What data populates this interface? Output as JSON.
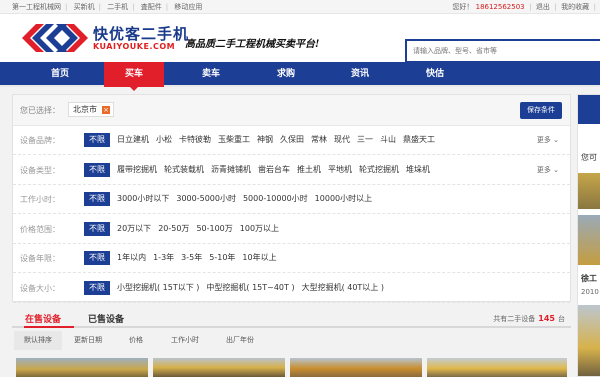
{
  "topbar": {
    "links": [
      "第一工程机械网",
      "买新机",
      "二手机",
      "査配件",
      "移动应用"
    ],
    "greeting": "您好！",
    "phone": "18612562503",
    "logout": "退出",
    "favorites": "我的收藏"
  },
  "header": {
    "logo_cn": "快优客二手机",
    "logo_en": "KUAIYOUKE.COM",
    "slogan": "高品质二手工程机械买卖平台!",
    "search_placeholder": "请输入品牌、型号、省市等"
  },
  "nav": {
    "items": [
      "首页",
      "买车",
      "卖车",
      "求购",
      "资讯",
      "快估"
    ],
    "active": "买车"
  },
  "filter": {
    "selected_label": "您已选择：",
    "selected_chip": "北京市",
    "save_label": "保存条件",
    "all_label": "不限",
    "more_label": "更多",
    "rows": [
      {
        "label": "设备品牌：",
        "options": [
          "日立建机",
          "小松",
          "卡特彼勒",
          "玉柴重工",
          "神钢",
          "久保田",
          "常林",
          "现代",
          "三一",
          "斗山",
          "鼎盛天工"
        ],
        "more": true
      },
      {
        "label": "设备类型：",
        "options": [
          "履带挖掘机",
          "轮式装载机",
          "沥青摊铺机",
          "凿岩台车",
          "推土机",
          "平地机",
          "轮式挖掘机",
          "堆垛机"
        ],
        "more": true
      },
      {
        "label": "工作小时：",
        "options": [
          "3000小时以下",
          "3000-5000小时",
          "5000-10000小时",
          "10000小时以上"
        ],
        "more": false
      },
      {
        "label": "价格范围：",
        "options": [
          "20万以下",
          "20-50万",
          "50-100万",
          "100万以上"
        ],
        "more": false
      },
      {
        "label": "设备年限：",
        "options": [
          "1年以内",
          "1-3年",
          "3-5年",
          "5-10年",
          "10年以上"
        ],
        "more": false
      },
      {
        "label": "设备大小：",
        "options": [
          "小型挖掘机( 15T以下 )",
          "中型挖掘机( 15T~40T )",
          "大型挖掘机( 40T以上 )"
        ],
        "more": false
      }
    ]
  },
  "tabs": {
    "on_sale": "在售设备",
    "sold": "已售设备",
    "count_prefix": "共有二手设备",
    "count": "145",
    "count_suffix": "台"
  },
  "sort": [
    "默认排序",
    "更新日期",
    "价格",
    "工作小时",
    "出厂年份"
  ],
  "right_col": {
    "heading": "您可",
    "item_title": "徐工",
    "item_year": "2010"
  },
  "colors": {
    "brand_blue": "#1c3e94",
    "brand_red": "#e01f2b",
    "phone_red": "#d71e1e",
    "count_red": "#e01f2b"
  }
}
